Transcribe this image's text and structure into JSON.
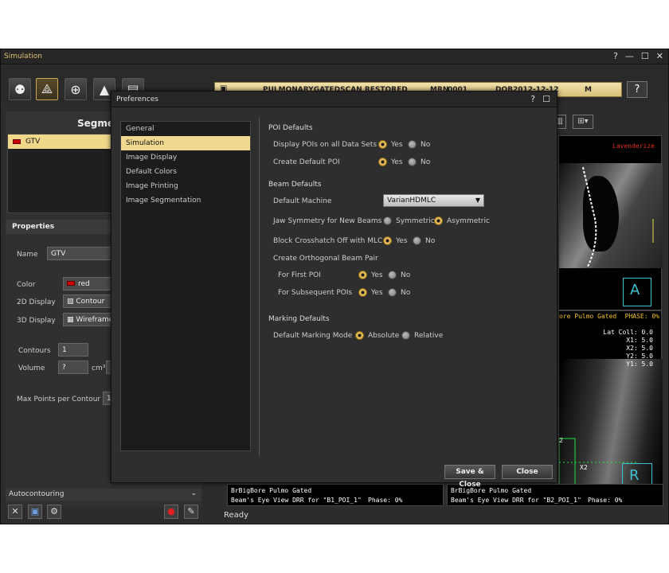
{
  "app": {
    "title": "Simulation",
    "window_controls": [
      "?",
      "—",
      "☐",
      "✕"
    ]
  },
  "patient": {
    "name": "PULMONARYGATEDSCAN RESTORED",
    "mrn_label": "MRN",
    "mrn": "0001",
    "dob_label": "DOB",
    "dob": "2012-12-12",
    "sex": "M",
    "help": "?"
  },
  "segmentation": {
    "header": "Segmentation",
    "structures": [
      {
        "name": "GTV",
        "color": "#cc0000"
      }
    ],
    "properties_header": "Properties",
    "name_label": "Name",
    "name_value": "GTV",
    "color_label": "Color",
    "color_value": "red",
    "display2d_label": "2D Display",
    "display2d_value": "Contour",
    "display3d_label": "3D Display",
    "display3d_value": "Wireframe",
    "contours_label": "Contours",
    "contours_value": "1",
    "volume_label": "Volume",
    "volume_value": "?",
    "volume_unit": "cm³",
    "maxpoints_label": "Max Points per Contour",
    "maxpoints_value": "1",
    "autocontouring_label": "Autocontouring"
  },
  "status": {
    "text": "Ready"
  },
  "viewers": {
    "brand": "Lavenderize",
    "top_right_title": "ore Pulmo Gated",
    "phase": "PHASE: 0%",
    "beam_readout": [
      "Lat Coll: 0.0",
      "X1: 5.0",
      "X2: 5.0",
      "Y2: 5.0",
      "Y1: 5.0"
    ],
    "marker_x2": "X2",
    "marker_2": "2",
    "marker_1": "1",
    "bottom_left_title": "BrBigBore Pulmo Gated",
    "bottom_left_desc": "Beam's Eye View DRR for \"B1_POI_1\"",
    "bottom_left_phase": "Phase: 0%",
    "bottom_right_title": "BrBigBore Pulmo Gated",
    "bottom_right_desc": "Beam's Eye View DRR for \"B2_POI_1\"",
    "bottom_right_phase": "Phase: 0%",
    "label_a": "A",
    "label_r": "R"
  },
  "dialog": {
    "title": "Preferences",
    "controls": [
      "?",
      "☐"
    ],
    "nav": [
      "General",
      "Simulation",
      "Image Display",
      "Default Colors",
      "Image Printing",
      "Image Segmentation"
    ],
    "nav_selected_index": 1,
    "poi_defaults": {
      "title": "POI Defaults",
      "display_pois_label": "Display POIs on all Data Sets",
      "display_pois_selected": "Yes",
      "create_default_label": "Create Default POI",
      "create_default_selected": "Yes"
    },
    "beam_defaults": {
      "title": "Beam Defaults",
      "default_machine_label": "Default Machine",
      "default_machine_value": "VarianHDMLC",
      "jaw_symmetry_label": "Jaw Symmetry for New Beams",
      "jaw_options": [
        "Symmetric",
        "Asymmetric"
      ],
      "jaw_selected": "Asymmetric",
      "crosshatch_label": "Block Crosshatch Off with MLC",
      "crosshatch_selected": "Yes",
      "orthogonal_label": "Create Orthogonal Beam Pair",
      "first_poi_label": "For First POI",
      "first_poi_selected": "Yes",
      "subsequent_label": "For Subsequent POIs",
      "subsequent_selected": "Yes"
    },
    "marking_defaults": {
      "title": "Marking Defaults",
      "mode_label": "Default Marking Mode",
      "mode_options": [
        "Absolute",
        "Relative"
      ],
      "mode_selected": "Absolute"
    },
    "yes": "Yes",
    "no": "No",
    "save_close": "Save & Close",
    "close": "Close"
  },
  "icons": {
    "accent": "#f0d88e",
    "selected_radio": "#f0c860"
  }
}
